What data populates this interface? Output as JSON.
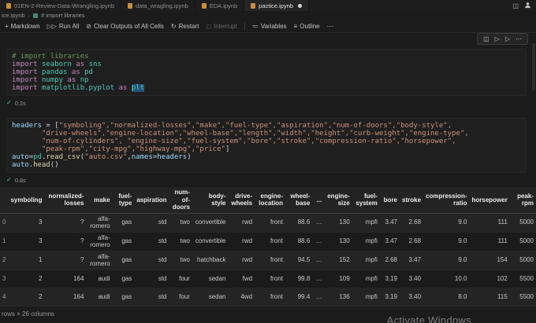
{
  "tabs": [
    {
      "label": "01EN-2-Review-Data-Wrangling.ipynb"
    },
    {
      "label": "data_wragling.ipynb"
    },
    {
      "label": "EDA.ipynb"
    },
    {
      "label": "pactice.ipynb",
      "modified": true
    }
  ],
  "breadcrumb": {
    "file": "ice.ipynb",
    "section": "# import libraries"
  },
  "toolbar": {
    "markdown": "Markdown",
    "run_all": "Run All",
    "clear_outputs": "Clear Outputs of All Cells",
    "restart": "Restart",
    "interrupt": "Interrupt",
    "variables": "Variables",
    "outline": "Outline"
  },
  "icons": {
    "plus": "+",
    "run_all": "▷▷",
    "clear": "⊘",
    "restart": "↻",
    "interrupt": "◻",
    "variables": "≔",
    "outline": "≡",
    "more": "⋯",
    "split_editor": "◫",
    "split_cell": "◫",
    "run_above": "▷",
    "run_below": "▷",
    "check": "✓",
    "chevron": "›"
  },
  "cells": [
    {
      "exec_time": "0.2s",
      "code": [
        [
          {
            "t": "# import libraries",
            "c": "cm"
          }
        ],
        [
          {
            "t": "import ",
            "c": "k"
          },
          {
            "t": "seaborn ",
            "c": "m"
          },
          {
            "t": "as ",
            "c": "k"
          },
          {
            "t": "sns",
            "c": "m"
          }
        ],
        [
          {
            "t": "import ",
            "c": "k"
          },
          {
            "t": "pandas ",
            "c": "m"
          },
          {
            "t": "as ",
            "c": "k"
          },
          {
            "t": "pd",
            "c": "m"
          }
        ],
        [
          {
            "t": "import ",
            "c": "k"
          },
          {
            "t": "numpy ",
            "c": "m"
          },
          {
            "t": "as ",
            "c": "k"
          },
          {
            "t": "np",
            "c": "m"
          }
        ],
        [
          {
            "t": "import ",
            "c": "k"
          },
          {
            "t": "matplotlib.pyplot ",
            "c": "m"
          },
          {
            "t": "as ",
            "c": "k"
          },
          {
            "t": "plt",
            "c": "m sel"
          }
        ]
      ]
    },
    {
      "exec_time": "0.8s",
      "code": [
        [
          {
            "t": "headers ",
            "c": "v"
          },
          {
            "t": "= [",
            "c": "p"
          },
          {
            "t": "\"symboling\",\"normalized-losses\",\"make\",\"fuel-type\",\"aspiration\",\"num-of-doors\",\"body-style\",",
            "c": "s"
          }
        ],
        [
          {
            "t": "       ",
            "c": "p"
          },
          {
            "t": "\"drive-wheels\",\"engine-location\",\"wheel-base\",\"length\",\"width\",\"height\",\"curb-weight\",\"engine-type\",",
            "c": "s"
          }
        ],
        [
          {
            "t": "       ",
            "c": "p"
          },
          {
            "t": "\"num-of-cylinders\", \"engine-size\",\"fuel-system\",\"bore\",\"stroke\",\"compression-ratio\",\"horsepower\",",
            "c": "s"
          }
        ],
        [
          {
            "t": "       ",
            "c": "p"
          },
          {
            "t": "\"peak-rpm\",\"city-mpg\",\"highway-mpg\",\"price\"",
            "c": "s"
          },
          {
            "t": "]",
            "c": "p"
          }
        ],
        [
          {
            "t": "auto",
            "c": "v"
          },
          {
            "t": "=",
            "c": "p"
          },
          {
            "t": "pd",
            "c": "m"
          },
          {
            "t": ".",
            "c": "p"
          },
          {
            "t": "read_csv",
            "c": "f"
          },
          {
            "t": "(",
            "c": "p"
          },
          {
            "t": "\"auto.csv\"",
            "c": "s"
          },
          {
            "t": ",",
            "c": "p"
          },
          {
            "t": "names",
            "c": "v"
          },
          {
            "t": "=",
            "c": "p"
          },
          {
            "t": "headers",
            "c": "v"
          },
          {
            "t": ")",
            "c": "p"
          }
        ],
        [
          {
            "t": "auto",
            "c": "v"
          },
          {
            "t": ".",
            "c": "p"
          },
          {
            "t": "head",
            "c": "f"
          },
          {
            "t": "()",
            "c": "p"
          }
        ]
      ]
    }
  ],
  "output_table": {
    "columns": [
      "",
      "symboling",
      "normalized-losses",
      "make",
      "fuel-type",
      "aspiration",
      "num-of-doors",
      "body-style",
      "drive-wheels",
      "engine-location",
      "wheel-base",
      "...",
      "engine-size",
      "fuel-system",
      "bore",
      "stroke",
      "compression-ratio",
      "horsepower",
      "peak-rpm"
    ],
    "rows": [
      [
        "0",
        "3",
        "?",
        "alfa-romero",
        "gas",
        "std",
        "two",
        "convertible",
        "rwd",
        "front",
        "88.6",
        "...",
        "130",
        "mpfi",
        "3.47",
        "2.68",
        "9.0",
        "111",
        "5000"
      ],
      [
        "1",
        "3",
        "?",
        "alfa-romero",
        "gas",
        "std",
        "two",
        "convertible",
        "rwd",
        "front",
        "88.6",
        "...",
        "130",
        "mpfi",
        "3.47",
        "2.68",
        "9.0",
        "111",
        "5000"
      ],
      [
        "2",
        "1",
        "?",
        "alfa-romero",
        "gas",
        "std",
        "two",
        "hatchback",
        "rwd",
        "front",
        "94.5",
        "...",
        "152",
        "mpfi",
        "2.68",
        "3.47",
        "9.0",
        "154",
        "5000"
      ],
      [
        "3",
        "2",
        "164",
        "audi",
        "gas",
        "std",
        "four",
        "sedan",
        "fwd",
        "front",
        "99.8",
        "...",
        "109",
        "mpfi",
        "3.19",
        "3.40",
        "10.0",
        "102",
        "5500"
      ],
      [
        "4",
        "2",
        "164",
        "audi",
        "gas",
        "std",
        "four",
        "sedan",
        "4wd",
        "front",
        "99.4",
        "...",
        "136",
        "mpfi",
        "3.19",
        "3.40",
        "8.0",
        "115",
        "5500"
      ]
    ],
    "footer": "rows × 26 columns"
  },
  "watermark": "Activate Windows",
  "colors": {
    "comment": "#6A9955",
    "keyword": "#C586C0",
    "module": "#4EC9B0",
    "string": "#CE9178",
    "function": "#DCDCAA",
    "variable": "#9CDCFE",
    "selection_bg": "#264F78",
    "success_check": "#73C991",
    "tab_icon": "#C98F3C"
  }
}
